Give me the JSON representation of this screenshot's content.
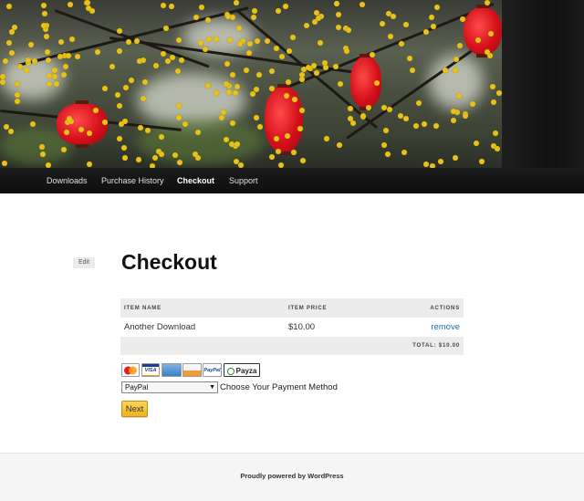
{
  "nav": {
    "items": [
      {
        "label": "Downloads"
      },
      {
        "label": "Purchase History"
      },
      {
        "label": "Checkout"
      },
      {
        "label": "Support"
      }
    ]
  },
  "page": {
    "edit_label": "Edit",
    "title": "Checkout"
  },
  "cart": {
    "headers": {
      "name": "ITEM NAME",
      "price": "ITEM PRICE",
      "actions": "ACTIONS"
    },
    "rows": [
      {
        "name": "Another Download",
        "price": "$10.00",
        "action": "remove"
      }
    ],
    "total": "TOTAL: $10.00"
  },
  "payment_icons": [
    {
      "icon": "mastercard-icon"
    },
    {
      "icon": "visa-icon",
      "text": "VISA"
    },
    {
      "icon": "amex-icon"
    },
    {
      "icon": "discover-icon"
    },
    {
      "icon": "paypal-icon",
      "text": "PayPal"
    },
    {
      "icon": "payza-icon",
      "text": "Payza"
    }
  ],
  "gateway": {
    "selected": "PayPal",
    "label": "Choose Your Payment Method"
  },
  "next_label": "Next",
  "footer": {
    "text": "Proudly powered by WordPress"
  },
  "colors": {
    "link": "#1e73be",
    "next_button": "#f5c33b",
    "nav_bg": "#111111"
  }
}
